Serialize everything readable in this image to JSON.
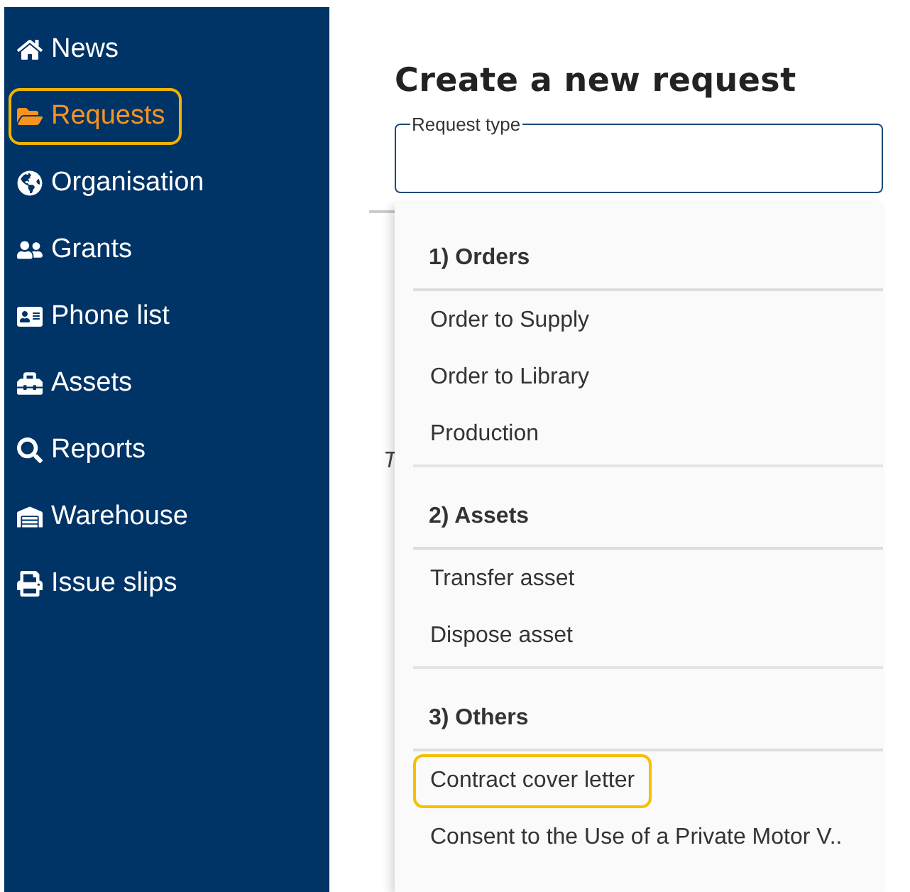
{
  "sidebar": {
    "items": [
      {
        "label": "News",
        "selected": false
      },
      {
        "label": "Requests",
        "selected": true
      },
      {
        "label": "Organisation",
        "selected": false
      },
      {
        "label": "Grants",
        "selected": false
      },
      {
        "label": "Phone list",
        "selected": false
      },
      {
        "label": "Assets",
        "selected": false
      },
      {
        "label": "Reports",
        "selected": false
      },
      {
        "label": "Warehouse",
        "selected": false
      },
      {
        "label": "Issue slips",
        "selected": false
      }
    ]
  },
  "main": {
    "title": "Create a new request",
    "background_text": "T",
    "request_type": {
      "label": "Request type"
    },
    "dropdown": {
      "groups": [
        {
          "title": "1) Orders",
          "items": [
            {
              "label": "Order to Supply",
              "selected": false
            },
            {
              "label": "Order to Library",
              "selected": false
            },
            {
              "label": "Production",
              "selected": false
            }
          ]
        },
        {
          "title": "2) Assets",
          "items": [
            {
              "label": "Transfer asset",
              "selected": false
            },
            {
              "label": "Dispose asset",
              "selected": false
            }
          ]
        },
        {
          "title": "3) Others",
          "items": [
            {
              "label": "Contract cover letter",
              "selected": true
            },
            {
              "label": "Consent to the Use of a Private Motor V..",
              "selected": false
            }
          ]
        }
      ]
    }
  }
}
